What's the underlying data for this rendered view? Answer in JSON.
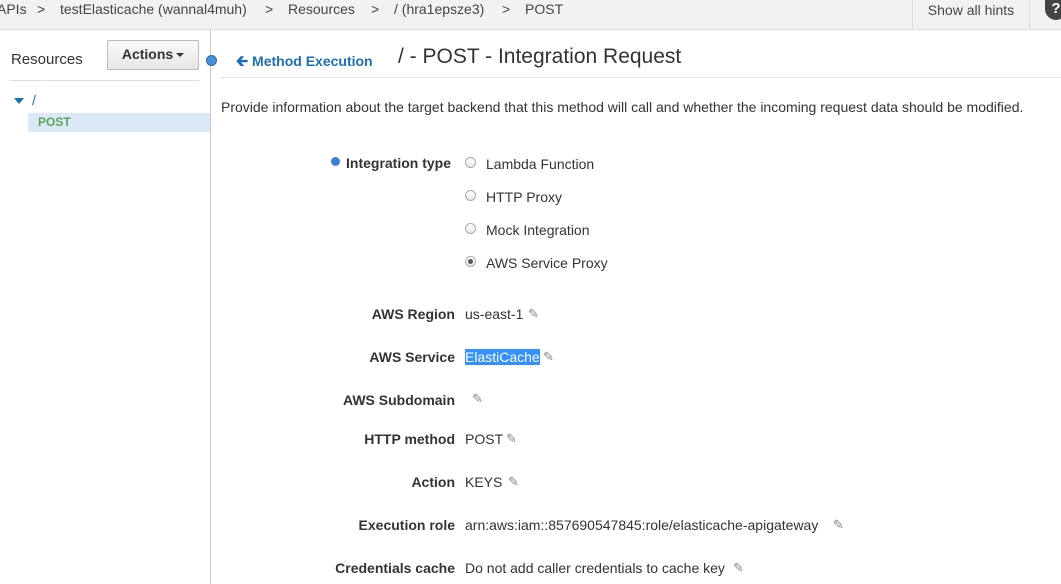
{
  "breadcrumb": {
    "items": [
      "APIs",
      "testElasticache (wannal4muh)",
      "Resources",
      "/ (hra1epsze3)",
      "POST"
    ],
    "separator": ">"
  },
  "topbar": {
    "hints_label": "Show all hints",
    "help_icon": "?"
  },
  "sidebar": {
    "title": "Resources",
    "actions_label": "Actions",
    "tree": {
      "root": "/",
      "child": "POST"
    }
  },
  "main": {
    "back_label": "Method Execution",
    "title": "/ - POST - Integration Request",
    "description": "Provide information about the target backend that this method will call and whether the incoming request data should be modified.",
    "integration_type": {
      "label": "Integration type",
      "options": [
        "Lambda Function",
        "HTTP Proxy",
        "Mock Integration",
        "AWS Service Proxy"
      ],
      "selected": "AWS Service Proxy"
    },
    "fields": {
      "aws_region": {
        "label": "AWS Region",
        "value": "us-east-1"
      },
      "aws_service": {
        "label": "AWS Service",
        "value": "ElastiCache"
      },
      "aws_subdomain": {
        "label": "AWS Subdomain",
        "value": ""
      },
      "http_method": {
        "label": "HTTP method",
        "value": "POST"
      },
      "action": {
        "label": "Action",
        "value": "KEYS"
      },
      "execution_role": {
        "label": "Execution role",
        "value": "arn:aws:iam::857690547845:role/elasticache-apigateway"
      },
      "credentials_cache": {
        "label": "Credentials cache",
        "value": "Do not add caller credentials to cache key"
      }
    }
  },
  "colors": {
    "accent": "#1a6fb5",
    "selection": "#3391ff",
    "tree_post": "#5aa55a"
  }
}
